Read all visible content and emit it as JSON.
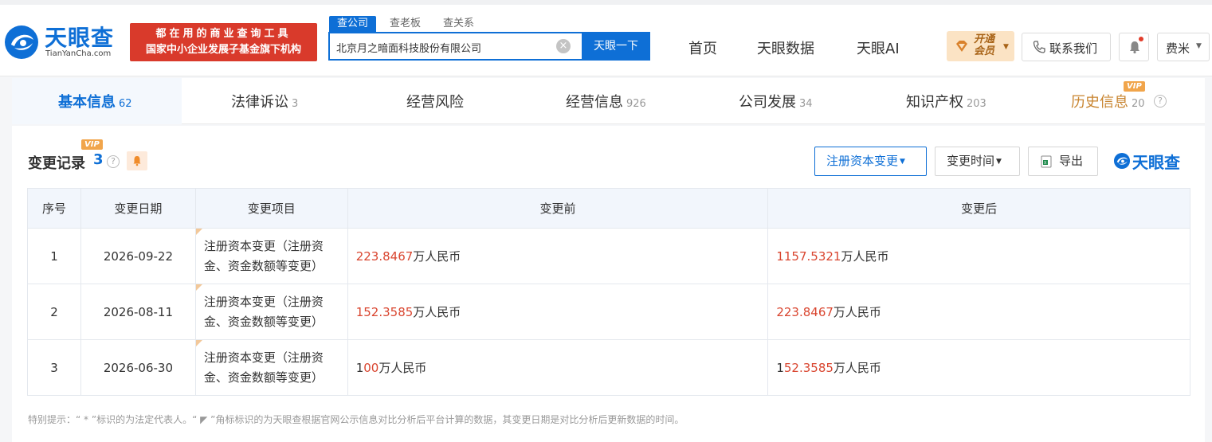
{
  "header": {
    "logo_cn": "天眼查",
    "logo_en": "TianYanCha.com",
    "banner_line1": "都在用的商业查询工具",
    "banner_line2": "国家中小企业发展子基金旗下机构",
    "search_tabs": [
      "查公司",
      "查老板",
      "查关系"
    ],
    "search_value": "北京月之暗面科技股份有限公司",
    "search_button": "天眼一下",
    "nav": [
      "首页",
      "天眼数据",
      "天眼AI"
    ],
    "vip_label": "开通会员",
    "contact_label": "联系我们",
    "user_name": "费米"
  },
  "tabs": [
    {
      "label": "基本信息",
      "count": "62"
    },
    {
      "label": "法律诉讼",
      "count": "3"
    },
    {
      "label": "经营风险",
      "count": ""
    },
    {
      "label": "经营信息",
      "count": "926"
    },
    {
      "label": "公司发展",
      "count": "34"
    },
    {
      "label": "知识产权",
      "count": "203"
    },
    {
      "label": "历史信息",
      "count": "20"
    }
  ],
  "vip_tag": "VIP",
  "section": {
    "title": "变更记录",
    "count": "3",
    "filter_type": "注册资本变更",
    "filter_time": "变更时间",
    "export_label": "导出",
    "brand": "天眼查"
  },
  "table": {
    "headers": [
      "序号",
      "变更日期",
      "变更项目",
      "变更前",
      "变更后"
    ],
    "rows": [
      {
        "no": "1",
        "date": "2026-09-22",
        "item": "注册资本变更（注册资金、资金数额等变更）",
        "before_prefix": "",
        "before_hl": "223.8467",
        "before_suffix": "万人民币",
        "after_prefix": "",
        "after_hl": "1157.5321",
        "after_suffix": "万人民币"
      },
      {
        "no": "2",
        "date": "2026-08-11",
        "item": "注册资本变更（注册资金、资金数额等变更）",
        "before_prefix": "",
        "before_hl": "152.3585",
        "before_suffix": "万人民币",
        "after_prefix": "",
        "after_hl": "223.8467",
        "after_suffix": "万人民币"
      },
      {
        "no": "3",
        "date": "2026-06-30",
        "item": "注册资本变更（注册资金、资金数额等变更）",
        "before_prefix": "1",
        "before_hl": "00",
        "before_suffix": "万人民币",
        "after_prefix": "1",
        "after_hl": "52.3585",
        "after_suffix": "万人民币"
      }
    ]
  },
  "footnote": "特别提示：“ * ”标识的为法定代表人。“ ◤ ”角标标识的为天眼查根据官网公示信息对比分析后平台计算的数据，其变更日期是对比分析后更新数据的时间。",
  "colors": {
    "brand_blue": "#0e6fd6",
    "highlight_red": "#d9452f",
    "banner_red": "#d93a2b",
    "vip_gold": "#c8842f"
  }
}
